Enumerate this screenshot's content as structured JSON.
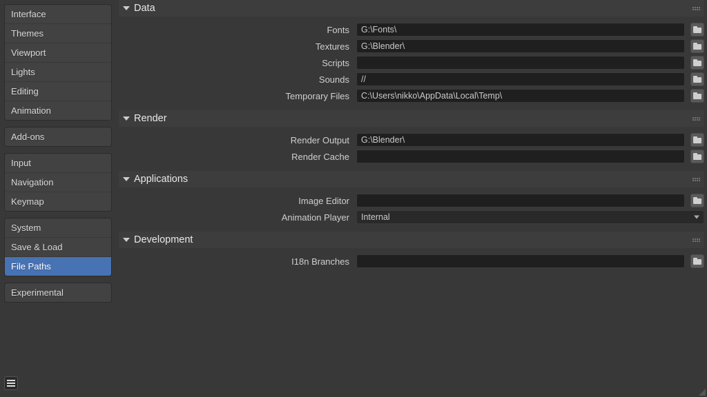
{
  "sidebar": {
    "groups": [
      {
        "items": [
          "Interface",
          "Themes",
          "Viewport",
          "Lights",
          "Editing",
          "Animation"
        ]
      },
      {
        "items": [
          "Add-ons"
        ]
      },
      {
        "items": [
          "Input",
          "Navigation",
          "Keymap"
        ]
      },
      {
        "items": [
          "System",
          "Save & Load",
          "File Paths"
        ],
        "active": "File Paths"
      },
      {
        "items": [
          "Experimental"
        ]
      }
    ]
  },
  "sections": {
    "data": {
      "title": "Data",
      "rows": [
        {
          "label": "Fonts",
          "value": "G:\\Fonts\\",
          "type": "path"
        },
        {
          "label": "Textures",
          "value": "G:\\Blender\\",
          "type": "path"
        },
        {
          "label": "Scripts",
          "value": "",
          "type": "path"
        },
        {
          "label": "Sounds",
          "value": "//",
          "type": "path"
        },
        {
          "label": "Temporary Files",
          "value": "C:\\Users\\nikko\\AppData\\Local\\Temp\\",
          "type": "path"
        }
      ]
    },
    "render": {
      "title": "Render",
      "rows": [
        {
          "label": "Render Output",
          "value": "G:\\Blender\\",
          "type": "path"
        },
        {
          "label": "Render Cache",
          "value": "",
          "type": "path"
        }
      ]
    },
    "applications": {
      "title": "Applications",
      "rows": [
        {
          "label": "Image Editor",
          "value": "",
          "type": "path"
        },
        {
          "label": "Animation Player",
          "value": "Internal",
          "type": "select"
        }
      ]
    },
    "development": {
      "title": "Development",
      "rows": [
        {
          "label": "I18n Branches",
          "value": "",
          "type": "path"
        }
      ]
    }
  }
}
